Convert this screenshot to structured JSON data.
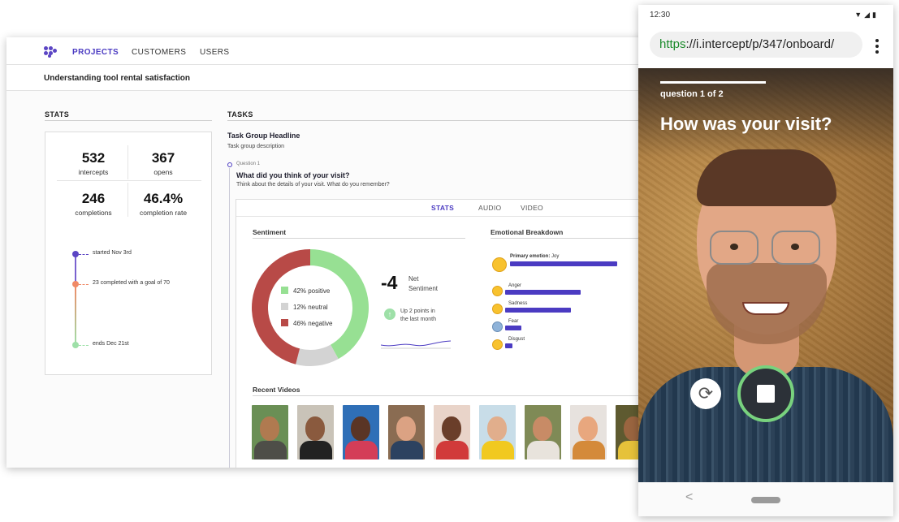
{
  "nav": {
    "items": [
      "PROJECTS",
      "CUSTOMERS",
      "USERS"
    ],
    "active": "PROJECTS"
  },
  "page_title": "Understanding tool rental satisfaction",
  "stats": {
    "heading": "STATS",
    "intercepts": {
      "value": "532",
      "label": "intercepts"
    },
    "opens": {
      "value": "367",
      "label": "opens"
    },
    "completions": {
      "value": "246",
      "label": "completions"
    },
    "completion_rate": {
      "value": "46.4%",
      "label": "completion rate"
    },
    "timeline": {
      "start": "started Nov 3rd",
      "progress": "23 completed with a goal of 70",
      "end": "ends Dec 21st"
    }
  },
  "tasks": {
    "heading": "TASKS",
    "group_title": "Task Group Headline",
    "group_description": "Task group description",
    "question_label": "Question 1",
    "question": "What did you think of your visit?",
    "question_sub": "Think about the details of your visit. What do you remember?"
  },
  "panel": {
    "tabs": [
      "STATS",
      "AUDIO",
      "VIDEO"
    ],
    "active_tab": "STATS",
    "sentiment_heading": "Sentiment",
    "emotional_heading": "Emotional Breakdown",
    "recent_videos_heading": "Recent Videos",
    "net_value": "-4",
    "net_label_1": "Net",
    "net_label_2": "Sentiment",
    "trend_1": "Up 2 points in",
    "trend_2": "the last month"
  },
  "chart_data": {
    "type": "pie",
    "donut": true,
    "slices": [
      {
        "label": "42% positive",
        "value": 42,
        "color": "#97e093"
      },
      {
        "label": "12% neutral",
        "value": 12,
        "color": "#d3d3d3"
      },
      {
        "label": "46% negative",
        "value": 46,
        "color": "#b84a47"
      }
    ]
  },
  "emotions": {
    "primary_label": "Primary emotion:",
    "primary_value": "Joy",
    "items": [
      {
        "name": "Anger",
        "level": 0.62
      },
      {
        "name": "Sadness",
        "level": 0.54
      },
      {
        "name": "Fear",
        "level": 0.13
      },
      {
        "name": "Disgust",
        "level": 0.06
      }
    ],
    "joy_level": 0.88
  },
  "videos": {
    "count": 9
  },
  "phone": {
    "time": "12:30",
    "url_scheme": "https",
    "url_rest": "://i.intercept/p/347/onboard/",
    "question_counter": "question 1 of 2",
    "question": "How was your visit?",
    "colors": {
      "record_ring": "#78d27e",
      "accent": "#4b3bc2"
    }
  }
}
